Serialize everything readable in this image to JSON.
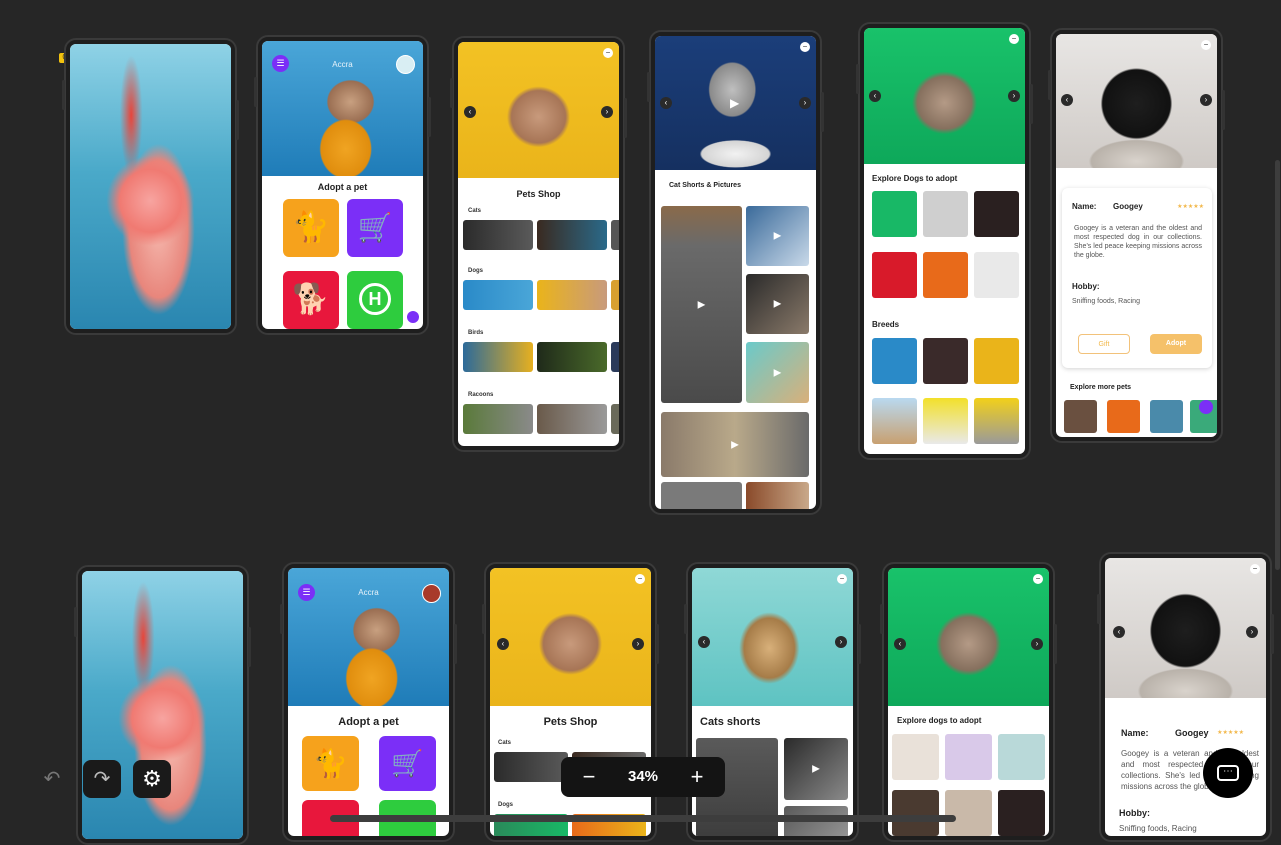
{
  "canvas": {
    "zoom_label": "34%",
    "frame_marker": "0"
  },
  "colors": {
    "canvas_bg": "#262626",
    "adopt_orange": "#f6a21c",
    "adopt_purple": "#7b2ff7",
    "adopt_red": "#e8173c",
    "adopt_green": "#2ecc3e",
    "gold": "#f2b84b"
  },
  "adopt_screen": {
    "city": "Accra",
    "title": "Adopt a pet",
    "tiles": [
      {
        "name": "cat",
        "icon": "cat-icon"
      },
      {
        "name": "shop",
        "icon": "cart-plus-icon"
      },
      {
        "name": "dog",
        "icon": "dog-icon"
      },
      {
        "name": "hospital",
        "icon": "hospital-icon",
        "glyph": "H"
      }
    ]
  },
  "shop_screen": {
    "title": "Pets Shop",
    "categories": [
      "Cats",
      "Dogs",
      "Birds",
      "Racoons"
    ]
  },
  "cats_screen": {
    "title": "Cat Shorts & Pictures",
    "title_alt": "Cats shorts"
  },
  "explore_screen": {
    "title": "Explore Dogs to adopt",
    "title_alt": "Explore dogs to adopt",
    "breeds_title": "Breeds"
  },
  "profile_screen": {
    "name_label": "Name:",
    "name_value": "Googey",
    "rating": "★★★★★",
    "description": "Googey is a veteran and the oldest and most respected dog in our collections. She's led peace keeping missions across the globe.",
    "hobby_label": "Hobby:",
    "hobby_value": "Sniffing foods, Racing",
    "gift_label": "Gift",
    "adopt_label": "Adopt",
    "explore_more": "Explore more pets"
  },
  "profile_screen_alt": {
    "name_label": "Name:",
    "name_value": "Googey",
    "rating": "★★★★★",
    "description": "Googey is a veteran and the oldest and most respected dog in our collections. She's led peace keeping missions across the globe.",
    "hobby_label": "Hobby:",
    "hobby_value": "Sniffing foods, Racing"
  },
  "toolbar": {
    "undo_icon": "undo-icon",
    "redo_icon": "redo-icon",
    "settings_icon": "gear-icon",
    "zoom_out_icon": "minus-icon",
    "zoom_in_icon": "plus-icon",
    "chat_icon": "chat-icon"
  }
}
